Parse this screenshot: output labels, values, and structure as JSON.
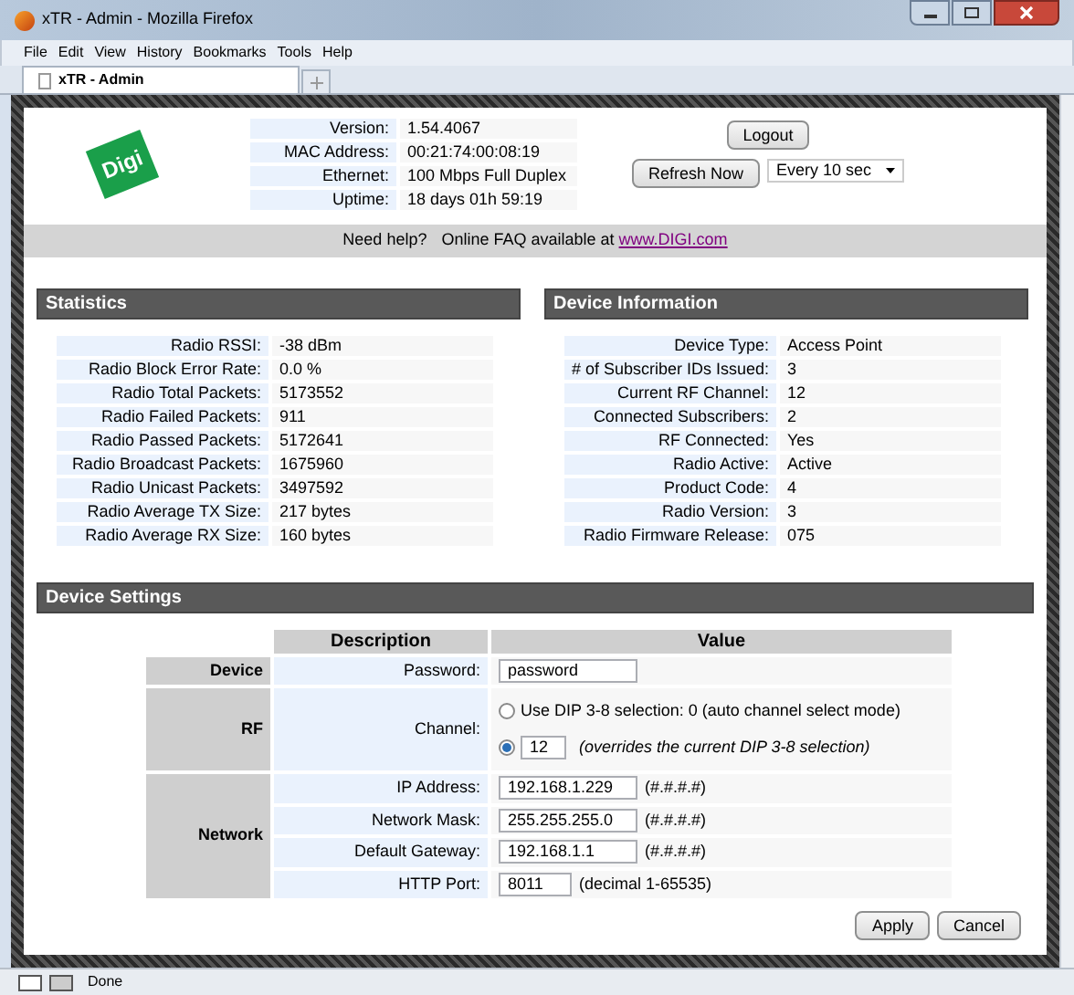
{
  "window": {
    "title": "xTR - Admin - Mozilla Firefox"
  },
  "menu": [
    "File",
    "Edit",
    "View",
    "History",
    "Bookmarks",
    "Tools",
    "Help"
  ],
  "tabs": [
    {
      "label": "xTR - Admin",
      "selected": true
    }
  ],
  "logo": "Digi",
  "info": [
    {
      "label": "Version:",
      "value": "1.54.4067"
    },
    {
      "label": "MAC Address:",
      "value": "00:21:74:00:08:19"
    },
    {
      "label": "Ethernet:",
      "value": "100 Mbps Full Duplex"
    },
    {
      "label": "Uptime:",
      "value": "18 days 01h 59:19"
    }
  ],
  "logout": "Logout",
  "refresh": "Refresh Now",
  "refresh_interval": "Every 10 sec",
  "help": {
    "lead": "Need help?",
    "text": "Online FAQ available at",
    "link": "www.DIGI.com"
  },
  "statistics": {
    "title": "Statistics",
    "rows": [
      {
        "label": "Radio RSSI:",
        "value": "-38 dBm"
      },
      {
        "label": "Radio Block Error Rate:",
        "value": "0.0 %"
      },
      {
        "label": "Radio Total Packets:",
        "value": "5173552"
      },
      {
        "label": "Radio Failed Packets:",
        "value": "911"
      },
      {
        "label": "Radio Passed Packets:",
        "value": "5172641"
      },
      {
        "label": "Radio Broadcast Packets:",
        "value": "1675960"
      },
      {
        "label": "Radio Unicast Packets:",
        "value": "3497592"
      },
      {
        "label": "Radio Average TX Size:",
        "value": "217 bytes"
      },
      {
        "label": "Radio Average RX Size:",
        "value": "160 bytes"
      }
    ]
  },
  "device_information": {
    "title": "Device Information",
    "rows": [
      {
        "label": "Device Type:",
        "value": "Access Point"
      },
      {
        "label": "# of Subscriber IDs Issued:",
        "value": "3"
      },
      {
        "label": "Current RF Channel:",
        "value": "12"
      },
      {
        "label": "Connected Subscribers:",
        "value": "2"
      },
      {
        "label": "RF Connected:",
        "value": "Yes"
      },
      {
        "label": "Radio Active:",
        "value": "Active"
      },
      {
        "label": "Product Code:",
        "value": "4"
      },
      {
        "label": "Radio Version:",
        "value": "3"
      },
      {
        "label": "Radio Firmware Release:",
        "value": "075"
      }
    ]
  },
  "device_settings": {
    "title": "Device Settings",
    "columns": [
      "Description",
      "Value"
    ],
    "groups": [
      {
        "name": "Device",
        "rows": [
          {
            "kind": "field",
            "label": "Password:",
            "value": "password"
          }
        ]
      },
      {
        "name": "RF",
        "rows": [
          {
            "kind": "radio",
            "label": "Channel:",
            "options": [
              {
                "kind": "text",
                "selected": false,
                "text": "Use DIP 3-8 selection: 0 (auto channel select mode)"
              },
              {
                "kind": "input",
                "selected": true,
                "value": "12",
                "note": "(overrides the current DIP 3-8 selection)"
              }
            ]
          }
        ]
      },
      {
        "name": "Network",
        "rows": [
          {
            "kind": "field",
            "label": "IP Address:",
            "value": "192.168.1.229",
            "note": "(#.#.#.#)"
          },
          {
            "kind": "field",
            "label": "Network Mask:",
            "value": "255.255.255.0",
            "note": "(#.#.#.#)"
          },
          {
            "kind": "field",
            "label": "Default Gateway:",
            "value": "192.168.1.1",
            "note": "(#.#.#.#)"
          },
          {
            "kind": "short_field",
            "label": "HTTP Port:",
            "value": "8011",
            "note": "(decimal 1-65535)"
          }
        ]
      }
    ],
    "buttons": [
      "Apply",
      "Cancel"
    ]
  },
  "status_bar": {
    "text": "Done"
  }
}
